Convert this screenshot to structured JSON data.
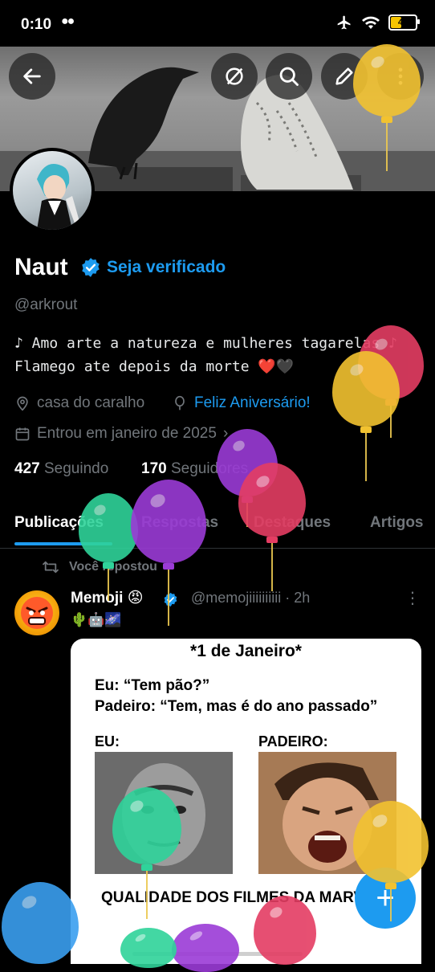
{
  "status_bar": {
    "time": "0:10",
    "battery": "42",
    "battery_level": 0.42
  },
  "profile": {
    "name": "Naut",
    "get_verified": "Seja verificado",
    "handle": "@arkrout",
    "bio_line1": "♪ Amo arte a natureza e mulheres tagarelas ♪",
    "bio_line2": "Flamego ate depois da morte ❤️🖤",
    "location": "casa do caralho",
    "birthday": "Feliz Aniversário!",
    "joined": "Entrou em janeiro de 2025",
    "following_count": "427",
    "following_label": "Seguindo",
    "followers_count": "170",
    "followers_label": "Seguidores"
  },
  "tabs": [
    "Publicações",
    "Respostas",
    "Destaques",
    "Artigos"
  ],
  "post": {
    "repost_label": "Você repostou",
    "author": "Memoji 😡",
    "handle_time": "@memojiiiiiiiiii · 2h",
    "emojis": "🌵🤖🌌",
    "menu": "⋮"
  },
  "meme": {
    "title": "*1 de Janeiro*",
    "line1": "Eu: “Tem pão?”",
    "line2": "Padeiro: “Tem, mas é do ano passado”",
    "label_left": "EU:",
    "label_right": "PADEIRO:",
    "bottom": "QUALIDADE DOS FILMES DA MARVEL"
  },
  "fab": "+",
  "colors": {
    "accent": "#1d9bf0",
    "background": "#000000",
    "muted": "#71767b"
  }
}
